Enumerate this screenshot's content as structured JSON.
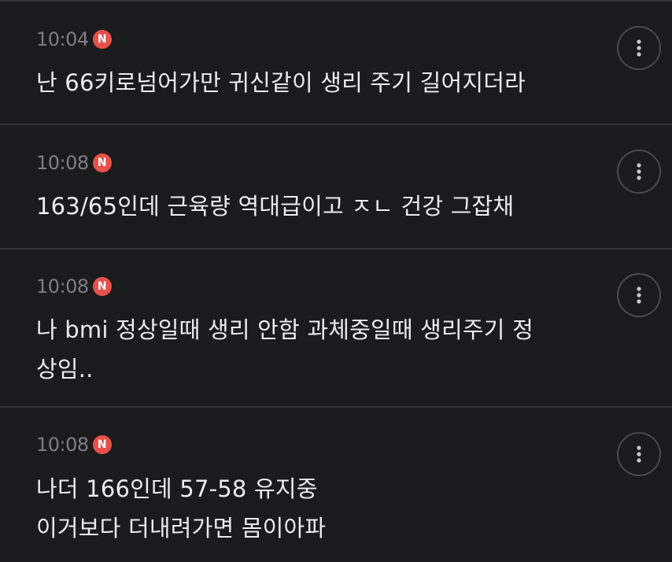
{
  "comments": [
    {
      "time": "10:04",
      "badge": "N",
      "lines": [
        "난 66키로넘어가만 귀신같이 생리 주기 길어지더라"
      ]
    },
    {
      "time": "10:08",
      "badge": "N",
      "lines": [
        "163/65인데 근육량 역대급이고 ㅈㄴ 건강 그잡채"
      ]
    },
    {
      "time": "10:08",
      "badge": "N",
      "lines": [
        "나 bmi 정상일때 생리 안함 과체중일때 생리주기 정",
        "상임.."
      ]
    },
    {
      "time": "10:08",
      "badge": "N",
      "lines": [
        "나더 166인데 57-58 유지중",
        "이거보다 더내려가면 몸이아파"
      ]
    }
  ],
  "colors": {
    "background": "#1b1b1d",
    "divider": "#343436",
    "time_text": "#7e7e82",
    "body_text": "#ececef",
    "new_badge": "#e8504a"
  },
  "icons": {
    "badge": "new-badge",
    "more": "vertical-ellipsis-icon"
  }
}
